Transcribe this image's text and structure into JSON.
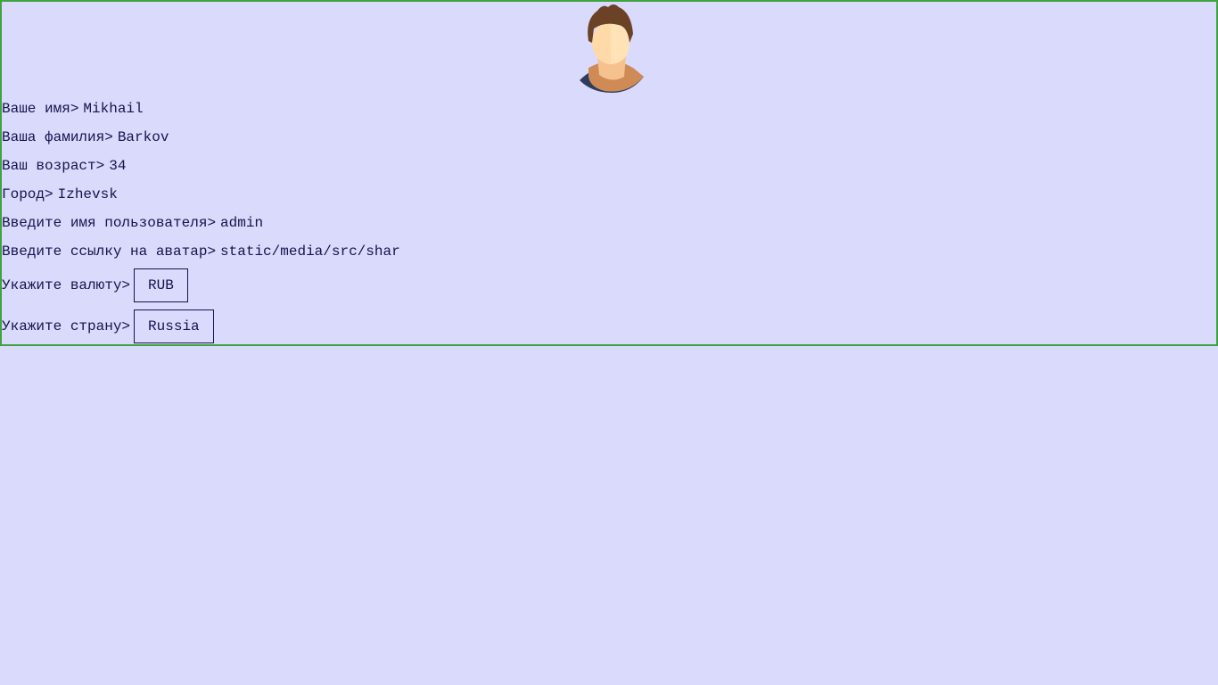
{
  "profile": {
    "avatar_icon": "user-avatar-icon",
    "fields": [
      {
        "label": "Ваше имя>",
        "value": "Mikhail"
      },
      {
        "label": "Ваша фамилия>",
        "value": "Barkov"
      },
      {
        "label": "Ваш возраст>",
        "value": "34"
      },
      {
        "label": "Город>",
        "value": "Izhevsk"
      },
      {
        "label": "Введите имя пользователя>",
        "value": "admin"
      },
      {
        "label": "Введите ссылку на аватар>",
        "value": "static/media/src/shar"
      }
    ],
    "currency": {
      "label": "Укажите валюту>",
      "value": "RUB"
    },
    "country": {
      "label": "Укажите страну>",
      "value": "Russia"
    }
  },
  "colors": {
    "background": "#dadafc",
    "border": "#3fa33f",
    "text": "#14144f"
  }
}
